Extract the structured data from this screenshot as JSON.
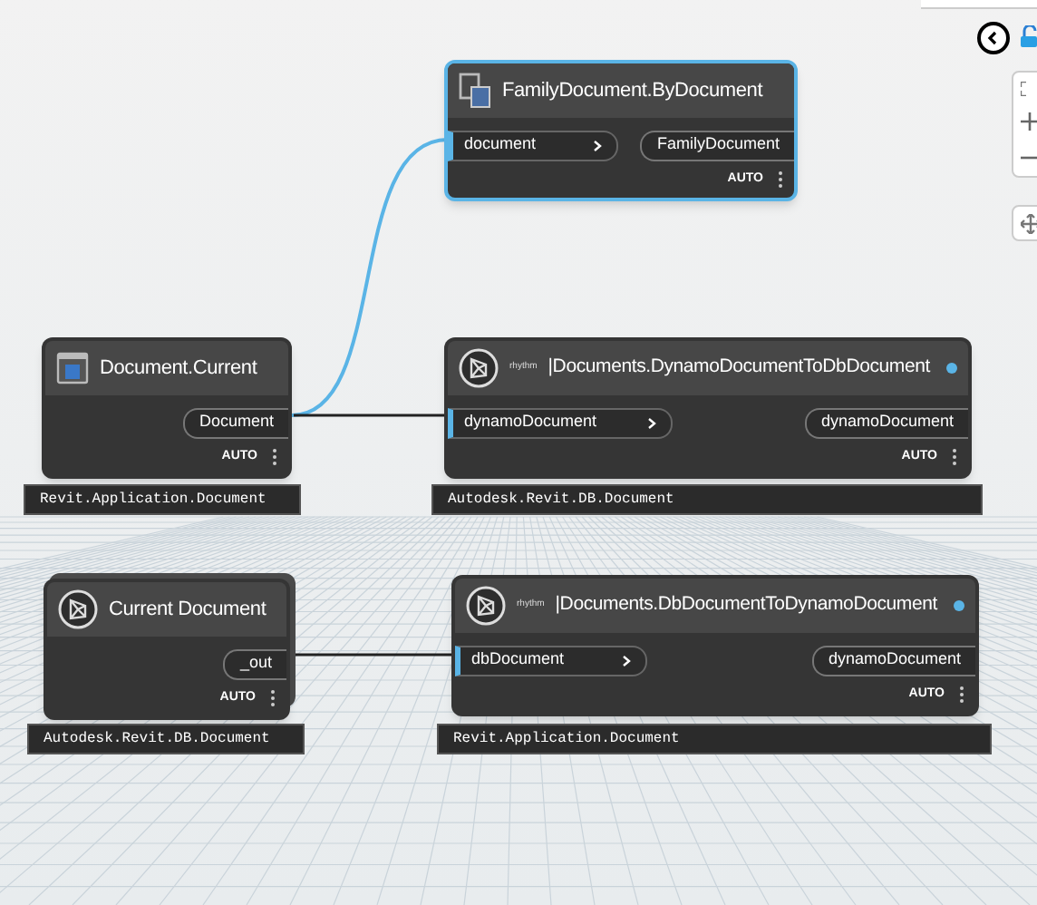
{
  "nodes": [
    {
      "kind": "zerotouch",
      "title": "FamilyDocument.ByDocument",
      "selected": true,
      "info_dot": false,
      "inputs": [
        "document"
      ],
      "outputs": [
        "FamilyDocument"
      ],
      "lacing": "AUTO"
    },
    {
      "kind": "ui",
      "title": "Document.Current",
      "selected": false,
      "info_dot": false,
      "outputs": [
        "Document"
      ],
      "lacing": "AUTO",
      "preview": "Revit.Application.Document"
    },
    {
      "kind": "custom",
      "prefix": "rhythm",
      "title": "|Documents.DynamoDocumentToDbDocument",
      "selected": false,
      "info_dot": true,
      "inputs": [
        "dynamoDocument"
      ],
      "outputs": [
        "dynamoDocument"
      ],
      "lacing": "AUTO",
      "preview": "Autodesk.Revit.DB.Document"
    },
    {
      "kind": "custom_stack",
      "title": "Current Document",
      "selected": false,
      "info_dot": false,
      "outputs": [
        "_out"
      ],
      "lacing": "AUTO",
      "preview": "Autodesk.Revit.DB.Document"
    },
    {
      "kind": "custom",
      "prefix": "rhythm",
      "title": "|Documents.DbDocumentToDynamoDocument",
      "selected": false,
      "info_dot": true,
      "inputs": [
        "dbDocument"
      ],
      "outputs": [
        "dynamoDocument"
      ],
      "lacing": "AUTO",
      "preview": "Revit.Application.Document"
    }
  ]
}
